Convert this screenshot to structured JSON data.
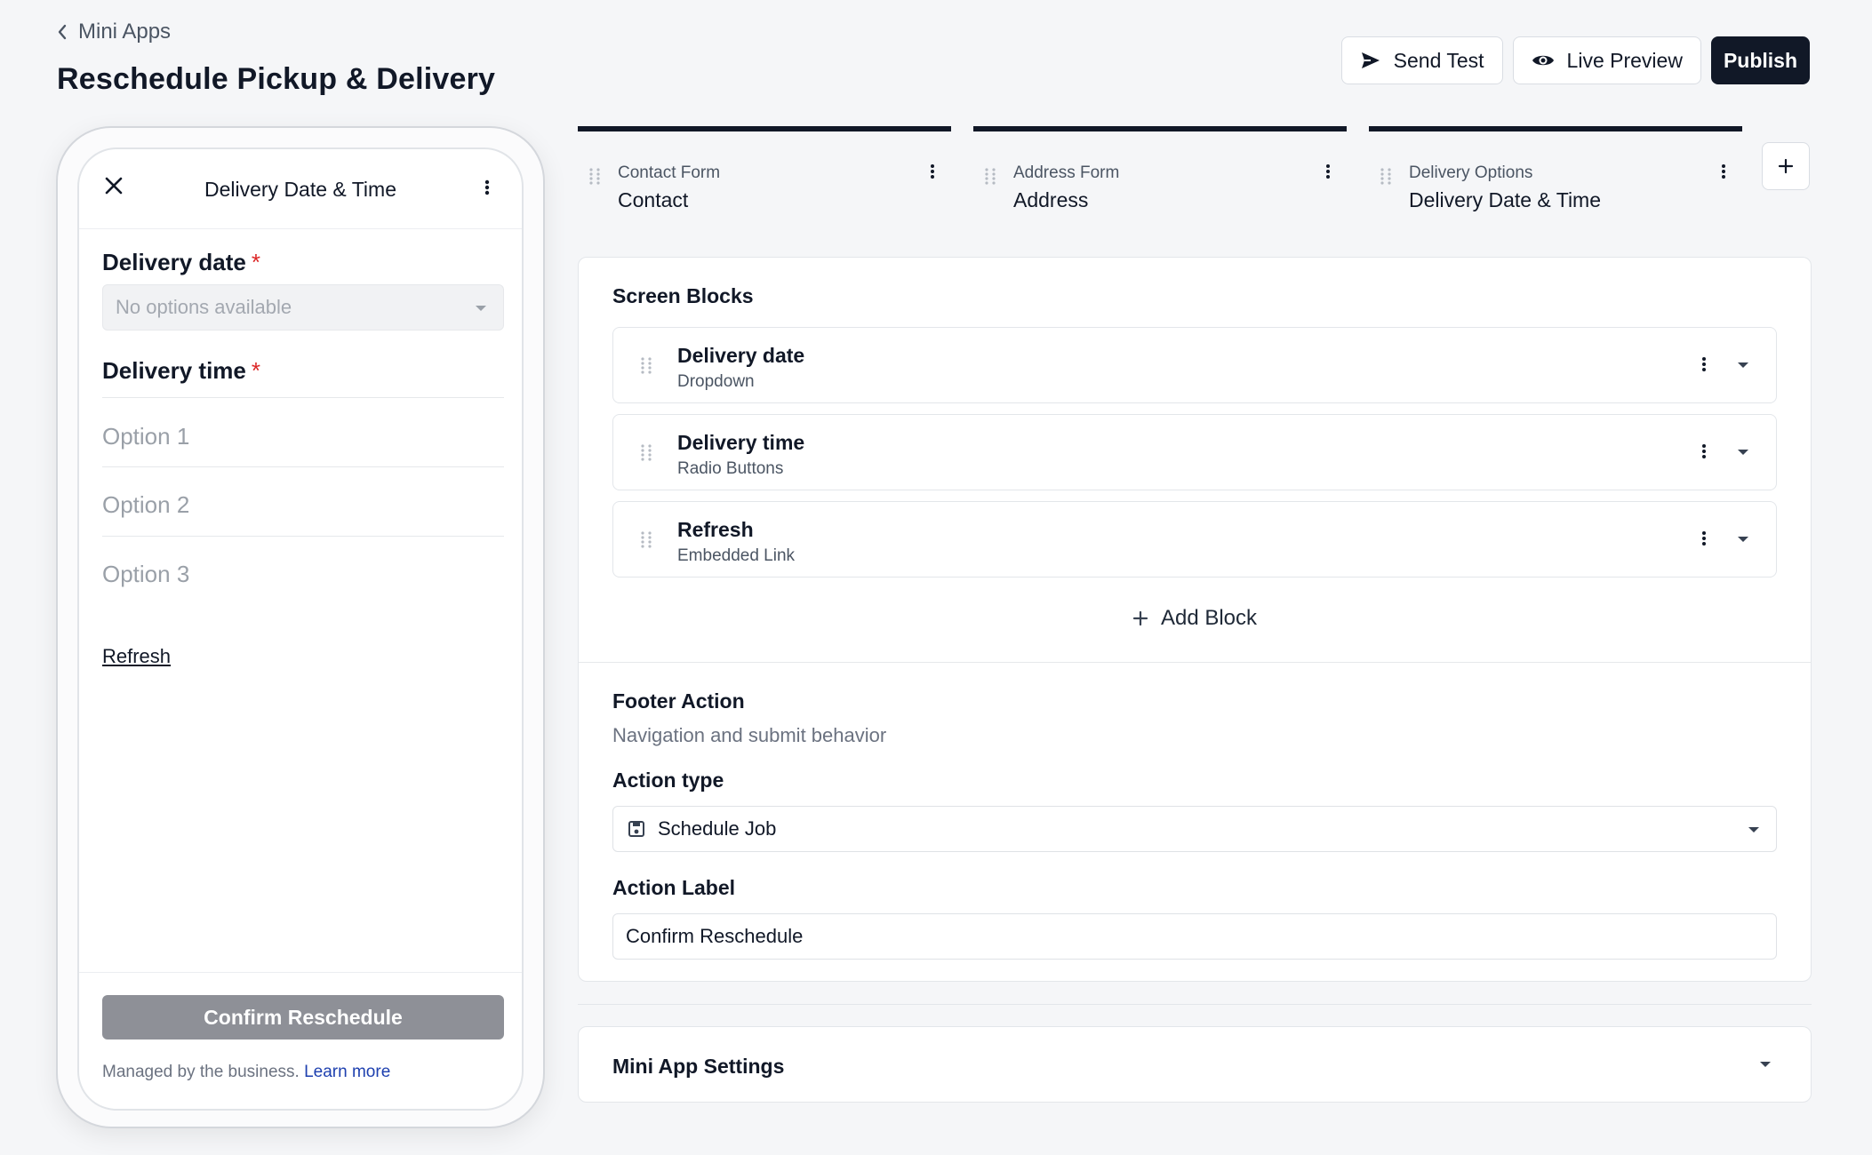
{
  "header": {
    "back_label": "Mini Apps",
    "title": "Reschedule Pickup & Delivery"
  },
  "toolbar": {
    "send_test_label": "Send Test",
    "live_preview_label": "Live Preview",
    "publish_label": "Publish"
  },
  "preview": {
    "screen_title": "Delivery Date & Time",
    "delivery_date_label": "Delivery date",
    "required_mark": "*",
    "delivery_date_placeholder": "No options available",
    "delivery_time_label": "Delivery time",
    "options": [
      "Option 1",
      "Option 2",
      "Option 3"
    ],
    "refresh_link": "Refresh",
    "cta_label": "Confirm Reschedule",
    "note_text": "Managed by the business.",
    "note_link": "Learn more"
  },
  "screens": [
    {
      "type": "Contact Form",
      "name": "Contact"
    },
    {
      "type": "Address Form",
      "name": "Address"
    },
    {
      "type": "Delivery Options",
      "name": "Delivery Date & Time"
    }
  ],
  "blocks_section": {
    "title": "Screen Blocks",
    "blocks": [
      {
        "name": "Delivery date",
        "type": "Dropdown"
      },
      {
        "name": "Delivery time",
        "type": "Radio Buttons"
      },
      {
        "name": "Refresh",
        "type": "Embedded Link"
      }
    ],
    "add_block_label": "Add Block"
  },
  "footer_action": {
    "title": "Footer Action",
    "subtitle": "Navigation and submit behavior",
    "action_type_label": "Action type",
    "action_type_value": "Schedule Job",
    "action_label_label": "Action Label",
    "action_label_value": "Confirm Reschedule"
  },
  "settings": {
    "title": "Mini App Settings"
  },
  "colors": {
    "primary": "#111827",
    "required": "#dc2626",
    "link": "#1e40af",
    "cta_disabled": "#8e9097",
    "background": "#f5f6f8"
  },
  "icons": [
    "chevron-left-icon",
    "send-icon",
    "eye-icon",
    "close-icon",
    "more-vertical-icon",
    "caret-down-icon",
    "drag-grip-icon",
    "plus-icon",
    "save-icon"
  ]
}
